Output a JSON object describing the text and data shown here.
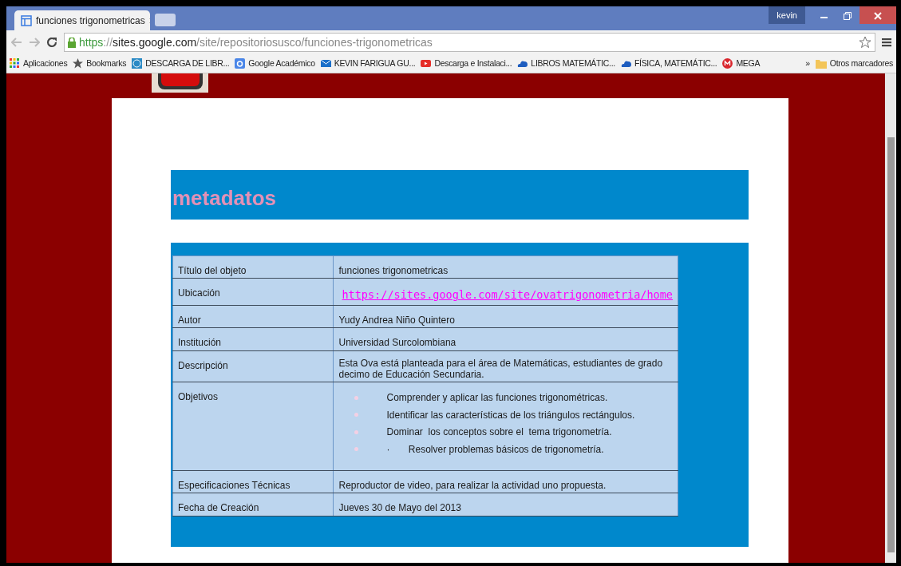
{
  "browser": {
    "tab": {
      "title": "funciones trigonometricas",
      "selected": true
    },
    "user": "kevin",
    "address": {
      "scheme": "https",
      "separator": "://",
      "host": "sites.google.com",
      "path": "/site/repositoriosusco/funciones-trigonometricas"
    },
    "bookmarks": [
      {
        "label": "Aplicaciones"
      },
      {
        "label": "Bookmarks"
      },
      {
        "label": "DESCARGA DE LIBR..."
      },
      {
        "label": "Google Académico"
      },
      {
        "label": "KEVIN FARIGUA GU..."
      },
      {
        "label": "Descarga e Instalaci..."
      },
      {
        "label": "LIBROS MATEMÁTIC..."
      },
      {
        "label": "FÍSICA, MATEMÁTIC..."
      },
      {
        "label": "MEGA"
      }
    ],
    "more": "»",
    "other_bookmarks": "Otros marcadores"
  },
  "page": {
    "heading": "metadatos",
    "rows": [
      {
        "kind": "text",
        "label": "Título del objeto",
        "value": "funciones trigonometricas"
      },
      {
        "kind": "link",
        "label": "Ubicación",
        "value": "https://sites.google.com/site/ovatrigonometria/home"
      },
      {
        "kind": "text",
        "label": "Autor",
        "value": "Yudy Andrea Niño Quintero"
      },
      {
        "kind": "text",
        "label": "Institución",
        "value": "Universidad Surcolombiana"
      },
      {
        "kind": "text",
        "label": "Descripción",
        "value": "Esta Ova está planteada para el área de Matemáticas, estudiantes de grado decimo de Educación Secundaria."
      },
      {
        "kind": "list",
        "label": "Objetivos",
        "items": [
          "Comprender y aplicar las funciones trigonométricas.",
          "Identificar las características de los triángulos rectángulos.",
          "Dominar  los conceptos sobre el  tema trigonometría.",
          "·       Resolver problemas básicos de trigonometría."
        ]
      },
      {
        "kind": "text",
        "label": "Especificaciones Técnicas",
        "value": "Reproductor de video, para realizar la actividad uno propuesta."
      },
      {
        "kind": "text",
        "label": "Fecha de Creación",
        "value": "Jueves 30 de Mayo del 2013"
      }
    ]
  }
}
